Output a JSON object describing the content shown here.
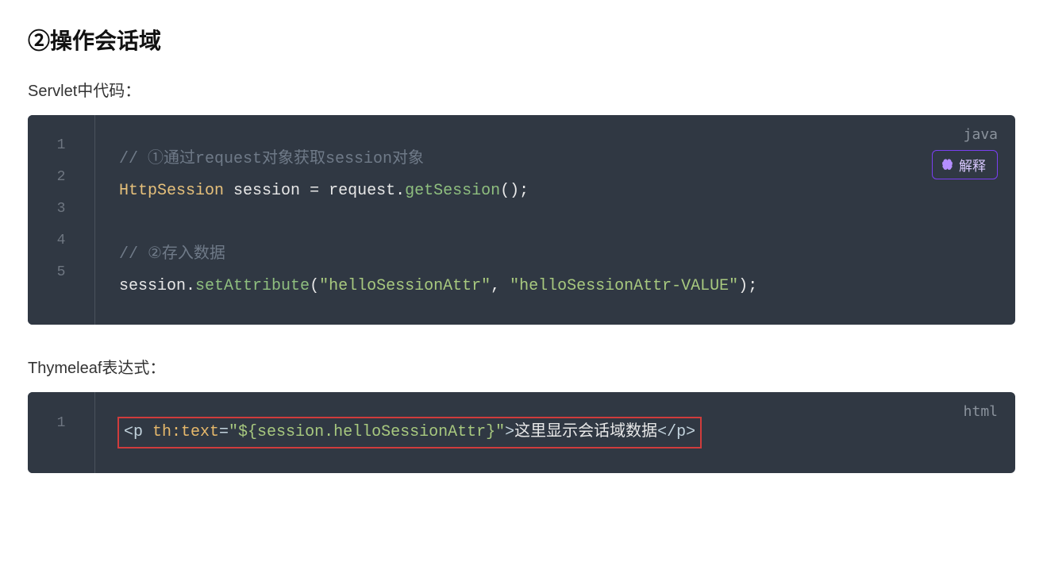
{
  "heading": "②操作会话域",
  "section1": {
    "label": "Servlet中代码：",
    "lang": "java",
    "explain_label": "解释",
    "line_numbers": [
      "1",
      "2",
      "3",
      "4",
      "5"
    ],
    "code": {
      "comment1_prefix": "// ①通过",
      "comment1_kw1": "request",
      "comment1_mid": "对象获取",
      "comment1_kw2": "session",
      "comment1_suffix": "对象",
      "type": "HttpSession",
      "var": "session",
      "eq": " = ",
      "obj1": "request",
      "dot1": ".",
      "call1": "getSession",
      "paren1": "();",
      "comment2": "// ②存入数据",
      "obj2": "session",
      "dot2": ".",
      "call2": "setAttribute",
      "open2": "(",
      "str1": "\"helloSessionAttr\"",
      "comma": ", ",
      "str2": "\"helloSessionAttr-VALUE\"",
      "close2": ");"
    }
  },
  "section2": {
    "label": "Thymeleaf表达式：",
    "lang": "html",
    "line_numbers": [
      "1"
    ],
    "code": {
      "open_tag": "<p ",
      "attr_name": "th:text",
      "eq": "=",
      "attr_val": "\"${session.helloSessionAttr}\"",
      "gt": ">",
      "inner": "这里显示会话域数据",
      "close_tag": "</p>"
    }
  }
}
